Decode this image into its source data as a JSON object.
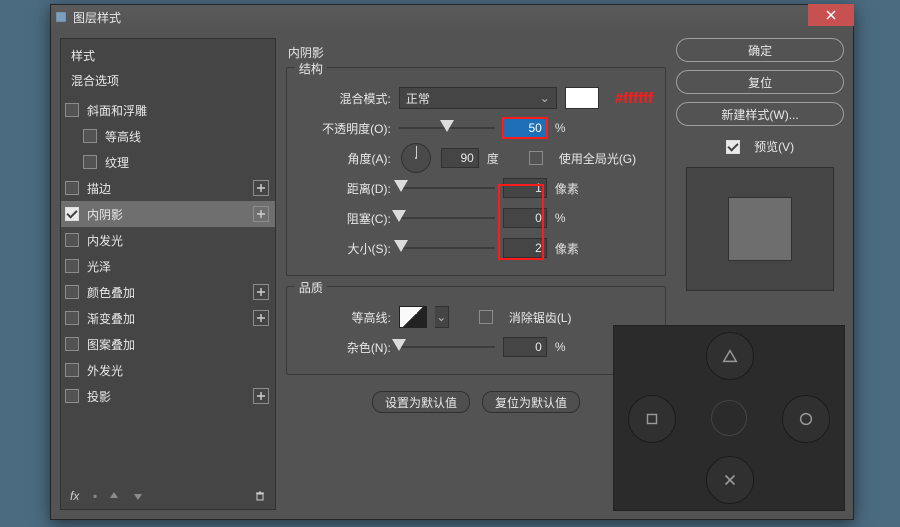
{
  "window": {
    "title": "图层样式"
  },
  "hex_annotation": "#ffffff",
  "left": {
    "head": "样式",
    "sub": "混合选项",
    "items": [
      {
        "label": "斜面和浮雕",
        "checked": false,
        "plus": false,
        "indent": false
      },
      {
        "label": "等高线",
        "checked": false,
        "plus": false,
        "indent": true
      },
      {
        "label": "纹理",
        "checked": false,
        "plus": false,
        "indent": true
      },
      {
        "label": "描边",
        "checked": false,
        "plus": true,
        "indent": false
      },
      {
        "label": "内阴影",
        "checked": true,
        "plus": true,
        "indent": false,
        "active": true
      },
      {
        "label": "内发光",
        "checked": false,
        "plus": false,
        "indent": false
      },
      {
        "label": "光泽",
        "checked": false,
        "plus": false,
        "indent": false
      },
      {
        "label": "颜色叠加",
        "checked": false,
        "plus": true,
        "indent": false
      },
      {
        "label": "渐变叠加",
        "checked": false,
        "plus": true,
        "indent": false
      },
      {
        "label": "图案叠加",
        "checked": false,
        "plus": false,
        "indent": false
      },
      {
        "label": "外发光",
        "checked": false,
        "plus": false,
        "indent": false
      },
      {
        "label": "投影",
        "checked": false,
        "plus": true,
        "indent": false
      }
    ]
  },
  "middle": {
    "section_title": "内阴影",
    "struct": {
      "legend": "结构",
      "blend_label": "混合模式:",
      "blend_value": "正常",
      "opacity_label": "不透明度(O):",
      "opacity_value": "50",
      "opacity_unit": "%",
      "angle_label": "角度(A):",
      "angle_value": "90",
      "angle_unit": "度",
      "global_light_label": "使用全局光(G)",
      "distance_label": "距离(D):",
      "distance_value": "1",
      "distance_unit": "像素",
      "choke_label": "阻塞(C):",
      "choke_value": "0",
      "choke_unit": "%",
      "size_label": "大小(S):",
      "size_value": "2",
      "size_unit": "像素"
    },
    "quality": {
      "legend": "品质",
      "contour_label": "等高线:",
      "anti_alias_label": "消除锯齿(L)",
      "noise_label": "杂色(N):",
      "noise_value": "0",
      "noise_unit": "%"
    },
    "buttons": {
      "default": "设置为默认值",
      "reset": "复位为默认值"
    }
  },
  "right": {
    "ok": "确定",
    "cancel": "复位",
    "new_style": "新建样式(W)...",
    "preview_label": "预览(V)"
  }
}
